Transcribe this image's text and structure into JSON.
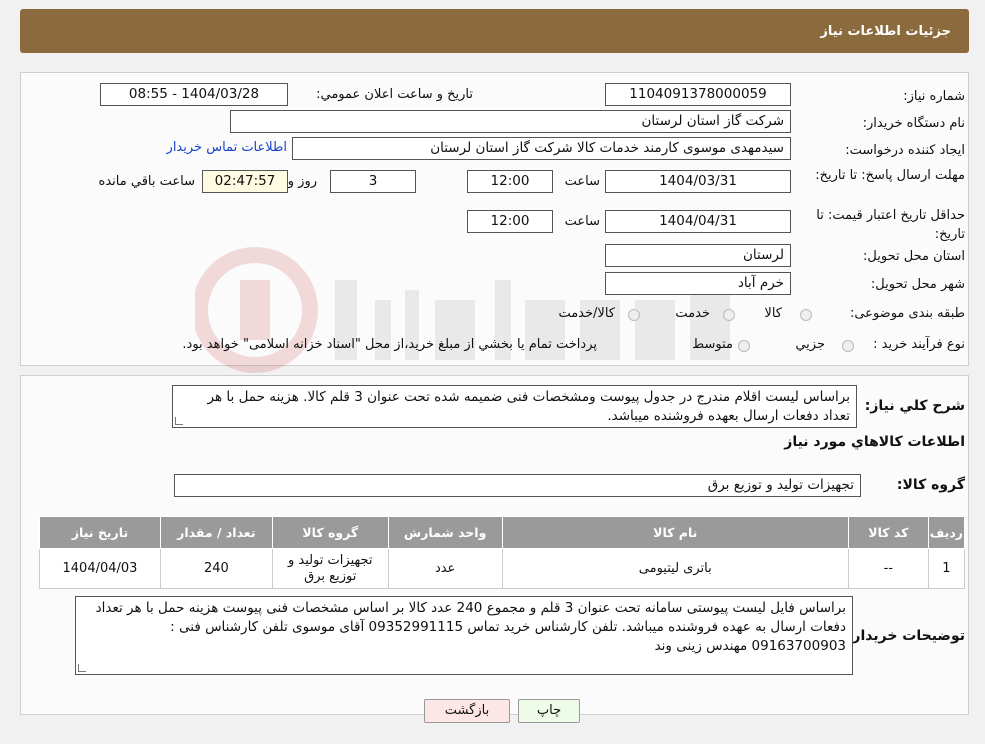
{
  "header": {
    "title": "جزئیات اطلاعات نیاز"
  },
  "form": {
    "need_number_label": "شماره نیاز:",
    "need_number": "1104091378000059",
    "announce_label": "تاریخ و ساعت اعلان عمومي:",
    "announce_value": "1404/03/28 - 08:55",
    "buyer_org_label": "نام دستگاه خريدار:",
    "buyer_org": "شرکت گاز استان لرستان",
    "creator_label": "ايجاد کننده درخواست:",
    "creator": "سیدمهدی موسوی کارمند خدمات کالا شرکت گاز استان لرستان",
    "contact_link": "اطلاعات تماس خريدار",
    "deadline_label": "مهلت ارسال پاسخ: تا تاریخ:",
    "deadline_date": "1404/03/31",
    "time_label": "ساعت",
    "deadline_time": "12:00",
    "days_value": "3",
    "days_label": "روز و",
    "remaining_time": "02:47:57",
    "remaining_label": "ساعت باقي مانده",
    "validity_label": "حداقل تاريخ اعتبار قيمت: تا تاریخ:",
    "validity_date": "1404/04/31",
    "validity_time": "12:00",
    "province_label": "استان محل تحويل:",
    "province": "لرستان",
    "city_label": "شهر محل تحويل:",
    "city": "خرم آباد",
    "category_label": "طبقه بندی موضوعی:",
    "category_options": [
      "کالا",
      "خدمت",
      "کالا/خدمت"
    ],
    "process_label": "نوع فرآيند خريد :",
    "process_options": [
      "جزيي",
      "متوسط"
    ],
    "process_note": "پرداخت تمام يا بخشي از مبلغ خريد،از محل \"اسناد خزانه اسلامی\" خواهد بود."
  },
  "description": {
    "label": "شرح کلي نياز:",
    "text": "براساس لیست اقلام مندرج در جدول پیوست ومشخصات فنی ضمیمه شده تحت عنوان 3 قلم کالا. هزینه حمل با هر تعداد دفعات ارسال بعهده فروشنده میباشد."
  },
  "goods": {
    "section_title": "اطلاعات کالاهاي مورد نياز",
    "group_label": "گروه کالا:",
    "group_value": "تجهیزات تولید و توزیع برق",
    "columns": [
      "رديف",
      "کد کالا",
      "نام کالا",
      "واحد شمارش",
      "گروه کالا",
      "تعداد / مقدار",
      "تاریخ نیاز"
    ],
    "rows": [
      [
        "1",
        "--",
        "باتری لیتیومی",
        "عدد",
        "تجهیزات تولید و توزیع برق",
        "240",
        "1404/04/03"
      ]
    ]
  },
  "buyer_notes": {
    "label": "توضيحات خريدار:",
    "text": "براساس  فایل لیست پیوستی سامانه تحت عنوان 3 قلم و مجموع 240 عدد کالا بر اساس مشخصات فنی پیوست هزینه حمل با هر تعداد دفعات ارسال به عهده فروشنده میباشد. تلفن کارشناس خرید تماس 09352991115 آقای موسوی تلفن کارشناس فنی : 09163700903 مهندس زینی وند"
  },
  "buttons": {
    "print": "چاپ",
    "back": "بازگشت"
  },
  "colors": {
    "header": "#8b6a3e",
    "link": "#1a44c8",
    "table_header": "#9a9a9a"
  }
}
